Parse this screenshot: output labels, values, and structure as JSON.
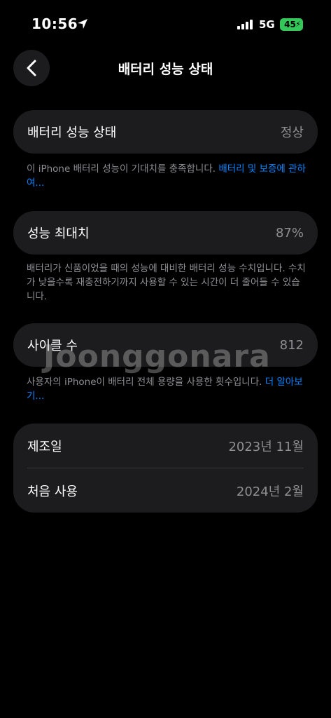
{
  "status": {
    "time": "10:56",
    "network": "5G",
    "battery": "45"
  },
  "nav": {
    "title": "배터리 성능 상태"
  },
  "battery_health": {
    "label": "배터리 성능 상태",
    "value": "정상",
    "note": "이 iPhone 배터리 성능이 기대치를 충족합니다. ",
    "note_link": "배터리 및 보증에 관하여..."
  },
  "max_capacity": {
    "label": "성능 최대치",
    "value": "87%",
    "note": "배터리가 신품이었을 때의 성능에 대비한 배터리 성능 수치입니다. 수치가 낮을수록 재충전하기까지 사용할 수 있는 시간이 더 줄어들 수 있습니다."
  },
  "cycle_count": {
    "label": "사이클 수",
    "value": "812",
    "note": "사용자의 iPhone이 배터리 전체 용량을 사용한 횟수입니다. ",
    "note_link": "더 알아보기..."
  },
  "manufacture": {
    "label": "제조일",
    "value": "2023년 11월"
  },
  "first_use": {
    "label": "처음 사용",
    "value": "2024년 2월"
  },
  "watermark": "Joonggonara"
}
